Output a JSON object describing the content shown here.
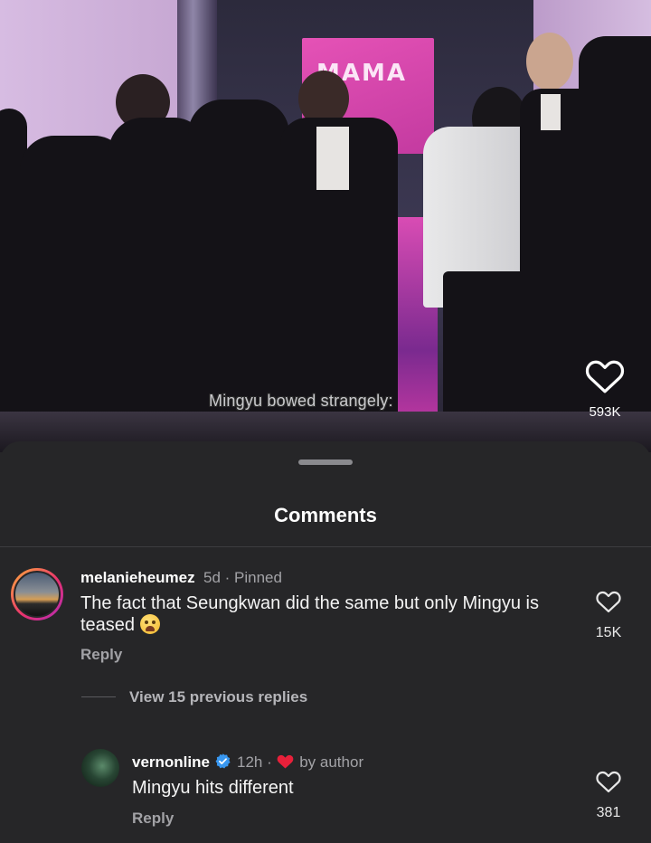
{
  "video": {
    "caption": "Mingyu bowed strangely:",
    "sign_text": "MAMA",
    "like_count": "593K"
  },
  "comments_sheet": {
    "title": "Comments",
    "view_replies": "View 15 previous replies",
    "comments": [
      {
        "username": "melanieheumez",
        "time": "5d",
        "tag": "Pinned",
        "text": "The fact that Seungkwan did the same but only Mingyu is teased",
        "emoji": "loudly-crying-face",
        "reply_label": "Reply",
        "likes": "15K"
      },
      {
        "username": "vernonline",
        "verified": true,
        "time": "12h",
        "liked_by": "by author",
        "text": "Mingyu hits different",
        "reply_label": "Reply",
        "likes": "381"
      }
    ]
  },
  "colors": {
    "background": "#262628",
    "liked_heart": "#e8203a",
    "verified_badge": "#3897f0"
  }
}
